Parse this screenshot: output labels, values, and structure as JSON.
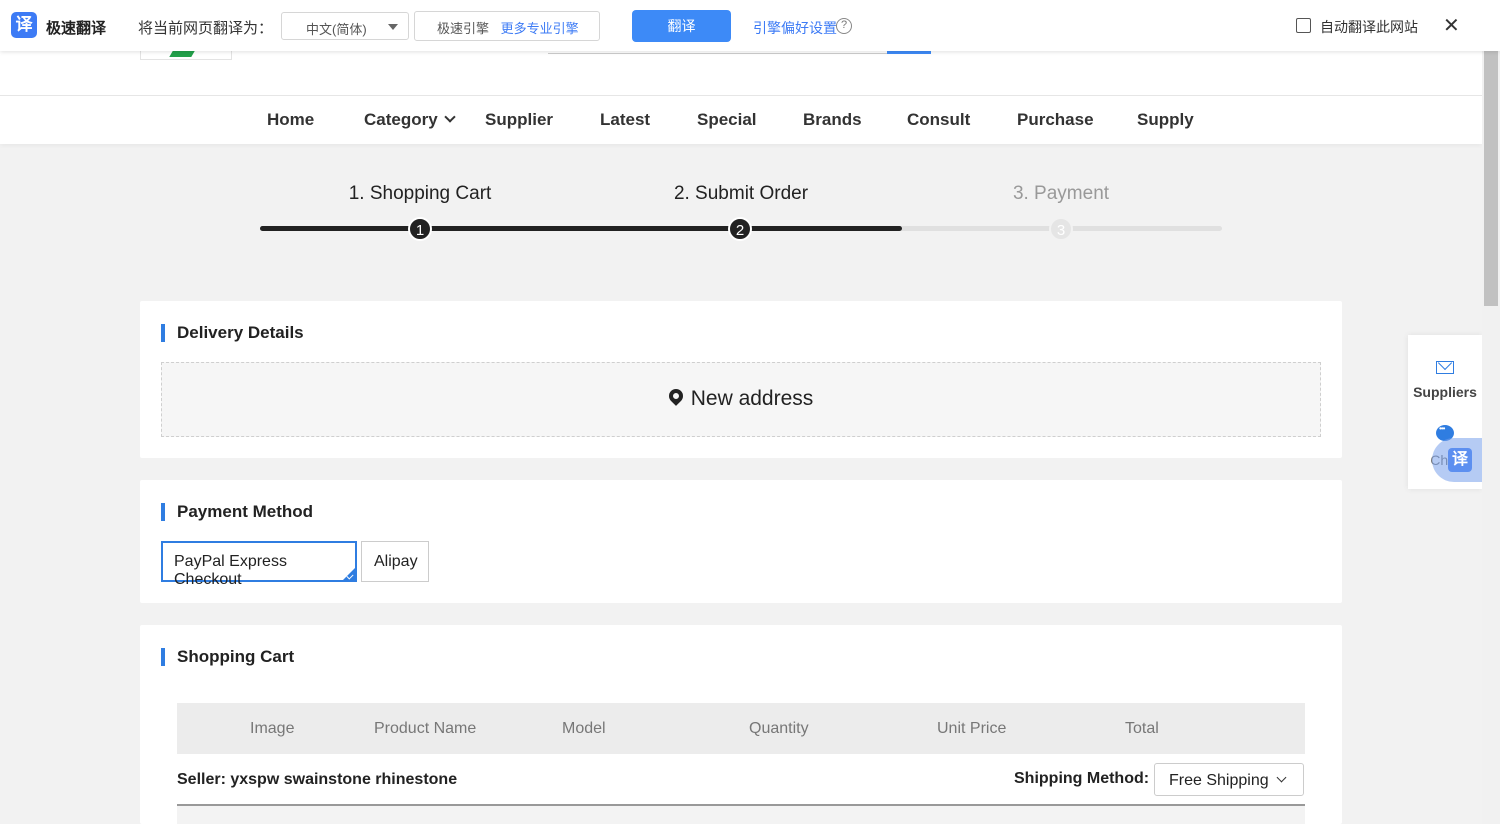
{
  "translate_bar": {
    "logo_glyph": "译",
    "brand": "极速翻译",
    "prompt": "将当前网页翻译为：",
    "language": "中文(简体)",
    "engine": "极速引擎",
    "engine_more": "更多专业引擎",
    "translate_button": "翻译",
    "preferences": "引擎偏好设置",
    "help_glyph": "?",
    "auto_translate_label": "自动翻译此网站",
    "close_glyph": "✕"
  },
  "nav": {
    "items": [
      "Home",
      "Category",
      "Supplier",
      "Latest",
      "Special",
      "Brands",
      "Consult",
      "Purchase",
      "Supply"
    ]
  },
  "steps": [
    {
      "label": "1. Shopping Cart",
      "num": "1",
      "state": "done"
    },
    {
      "label": "2. Submit Order",
      "num": "2",
      "state": "current"
    },
    {
      "label": "3. Payment",
      "num": "3",
      "state": "pending"
    }
  ],
  "delivery": {
    "title": "Delivery Details",
    "new_address": "New address"
  },
  "payment": {
    "title": "Payment Method",
    "options": [
      "PayPal Express Checkout",
      "Alipay"
    ],
    "selected": "PayPal Express Checkout"
  },
  "cart": {
    "title": "Shopping Cart",
    "columns": [
      "Image",
      "Product Name",
      "Model",
      "Quantity",
      "Unit Price",
      "Total"
    ],
    "seller": "Seller: yxspw swainstone rhinestone",
    "shipping_label": "Shipping Method:",
    "shipping_value": "Free Shipping"
  },
  "side": {
    "suppliers": "Suppliers",
    "chat": "Chat",
    "fab_glyph": "译"
  },
  "colors": {
    "accent": "#2f7de1",
    "translate_blue": "#3d8af7",
    "step_done": "#222222",
    "step_pending": "#e0e0e0"
  }
}
